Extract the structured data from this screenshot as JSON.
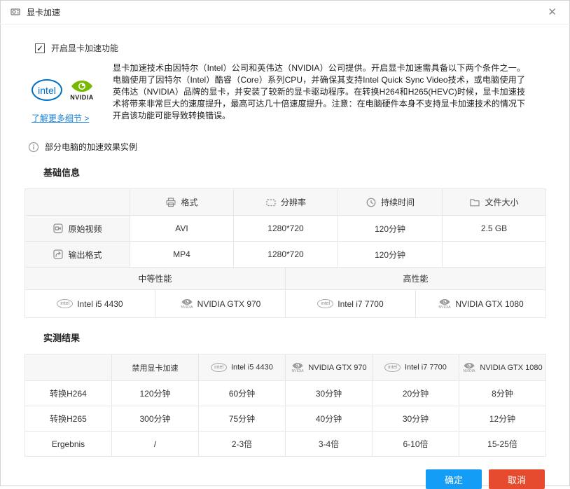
{
  "window": {
    "title": "显卡加速",
    "close_glyph": "✕"
  },
  "checkbox": {
    "label": "开启显卡加速功能",
    "checked": true
  },
  "logos": {
    "intel": "intel",
    "nvidia": "NVIDIA"
  },
  "icons": {
    "intel_text": "intel",
    "nvidia_text": "NVIDIA"
  },
  "description": "显卡加速技术由因特尔（Intel）公司和英伟达（NVIDIA）公司提供。开启显卡加速需具备以下两个条件之一。电脑使用了因特尔（Intel）酷睿（Core）系列CPU，并确保其支持Intel Quick Sync Video技术，或电脑使用了英伟达（NVIDIA）品牌的显卡，并安装了较新的显卡驱动程序。在转换H264和H265(HEVC)时候，显卡加速技术将带来非常巨大的速度提升，最高可达几十倍速度提升。注意：在电脑硬件本身不支持显卡加速技术的情况下开启该功能可能导致转换错误。",
  "link": {
    "label": "了解更多细节 >"
  },
  "example_header": "部分电脑的加速效果实例",
  "basic_info": {
    "title": "基础信息",
    "headers": [
      "格式",
      "分辨率",
      "持续时间",
      "文件大小"
    ],
    "rows": [
      {
        "label": "原始视频",
        "values": [
          "AVI",
          "1280*720",
          "120分钟",
          "2.5 GB"
        ]
      },
      {
        "label": "输出格式",
        "values": [
          "MP4",
          "1280*720",
          "120分钟",
          ""
        ]
      }
    ],
    "performance_groups": [
      "中等性能",
      "高性能"
    ],
    "gpus": [
      {
        "brand": "intel",
        "label": "Intel i5 4430"
      },
      {
        "brand": "nvidia",
        "label": "NVIDIA GTX 970"
      },
      {
        "brand": "intel",
        "label": "Intel i7 7700"
      },
      {
        "brand": "nvidia",
        "label": "NVIDIA GTX 1080"
      }
    ]
  },
  "results": {
    "title": "实测结果",
    "col_headers": [
      {
        "brand": "",
        "label": "禁用显卡加速"
      },
      {
        "brand": "intel",
        "label": "Intel i5 4430"
      },
      {
        "brand": "nvidia",
        "label": "NVIDIA GTX 970"
      },
      {
        "brand": "intel",
        "label": "Intel i7 7700"
      },
      {
        "brand": "nvidia",
        "label": "NVIDIA GTX 1080"
      }
    ],
    "rows": [
      {
        "label": "转换H264",
        "values": [
          "120分钟",
          "60分钟",
          "30分钟",
          "20分钟",
          "8分钟"
        ]
      },
      {
        "label": "转换H265",
        "values": [
          "300分钟",
          "75分钟",
          "40分钟",
          "30分钟",
          "12分钟"
        ]
      },
      {
        "label": "Ergebnis",
        "values": [
          "/",
          "2-3倍",
          "3-4倍",
          "6-10倍",
          "15-25倍"
        ]
      }
    ]
  },
  "buttons": {
    "ok": "确定",
    "cancel": "取消"
  },
  "colors": {
    "ok_button": "#149df6",
    "cancel_button": "#e64b30",
    "link": "#1a80d9",
    "intel_blue": "#0071c5",
    "nvidia_green": "#76b900"
  }
}
